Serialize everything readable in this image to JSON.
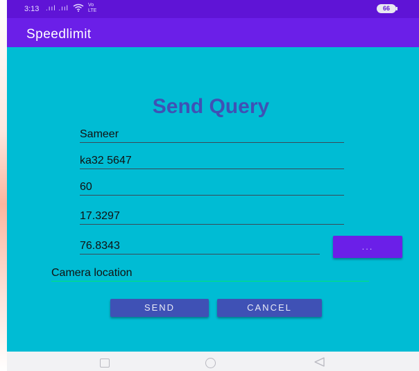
{
  "status_bar": {
    "time": "3:13",
    "signal_text": ".ııl .ııl",
    "lte_top": "Vo",
    "lte_bottom": "LTE",
    "battery": "66"
  },
  "app_bar": {
    "title": "Speedlimit"
  },
  "form": {
    "title": "Send Query",
    "name_value": "Sameer",
    "vehicle_value": "ka32 5647",
    "speed_value": "60",
    "latitude_value": "17.3297",
    "longitude_value": "76.8343",
    "location_value": "Camera location",
    "dots_label": "...",
    "send_label": "SEND",
    "cancel_label": "CANCEL"
  },
  "colors": {
    "status_bar": "#5f14d6",
    "app_bar": "#6b1fe8",
    "background": "#00bcd4",
    "title": "#3f51b5",
    "button": "#3f51b5",
    "location_underline": "#00e676"
  },
  "icons": {
    "wifi": "wifi-icon",
    "battery": "battery-icon",
    "nav_recent": "square-icon",
    "nav_home": "circle-icon",
    "nav_back": "triangle-back-icon"
  }
}
